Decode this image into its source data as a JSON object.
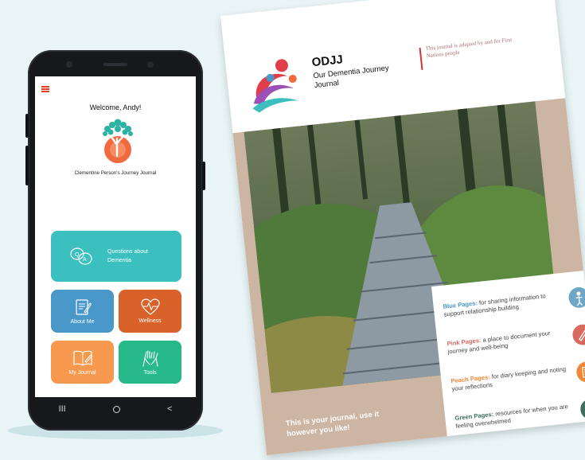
{
  "app": {
    "welcome": "Welcome, Andy!",
    "journal_name": "Clementine Person's Journey Journal",
    "tiles": {
      "questions": "Questions about Dementia",
      "about": "About Me",
      "wellness": "Wellness",
      "journal": "My Journal",
      "tools": "Tools"
    },
    "nav": {
      "recent": "III",
      "back": "<"
    }
  },
  "cover": {
    "title": "ODJJ",
    "subtitle": "Our Dementia Journey Journal",
    "adapted": "This journal is adapted by and for First Nations people",
    "tagline": "This is your journal, use it however you like!",
    "pages": [
      {
        "name": "Blue Pages:",
        "desc": " for sharing information to support relationship building",
        "color": "#4a97c9",
        "icon": "person-icon"
      },
      {
        "name": "Pink Pages:",
        "desc": " a place to document your journey and well-being",
        "color": "#d9685f",
        "icon": "pencil-icon"
      },
      {
        "name": "Peach Pages:",
        "desc": " for diary keeping and noting your reflections",
        "color": "#f0873a",
        "icon": "notes-icon"
      },
      {
        "name": "Green Pages:",
        "desc": " resources for when you are feeling overwhelmed",
        "color": "#3e6f5c",
        "icon": "globe-icon"
      }
    ]
  },
  "colors": {
    "teal": "#3bbfbf",
    "blue": "#4a97c9",
    "orange": "#d9622b",
    "peach": "#f6994f",
    "green": "#27b98a",
    "sand": "#cdb5a3"
  }
}
